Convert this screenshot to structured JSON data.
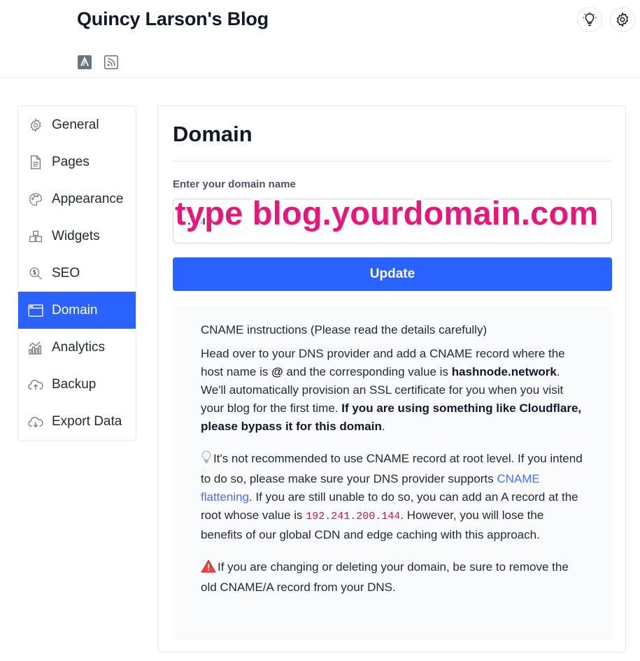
{
  "header": {
    "blog_title": "Quincy Larson's Blog",
    "social_icons": [
      "hashnode-icon",
      "rss-icon"
    ],
    "actions": [
      "lightbulb-icon",
      "gear-icon"
    ]
  },
  "sidebar": {
    "items": [
      {
        "label": "General",
        "icon": "gear-icon",
        "active": false
      },
      {
        "label": "Pages",
        "icon": "document-icon",
        "active": false
      },
      {
        "label": "Appearance",
        "icon": "palette-icon",
        "active": false
      },
      {
        "label": "Widgets",
        "icon": "widgets-icon",
        "active": false
      },
      {
        "label": "SEO",
        "icon": "search-dollar-icon",
        "active": false
      },
      {
        "label": "Domain",
        "icon": "browser-window-icon",
        "active": true
      },
      {
        "label": "Analytics",
        "icon": "bar-chart-icon",
        "active": false
      },
      {
        "label": "Backup",
        "icon": "cloud-upload-icon",
        "active": false
      },
      {
        "label": "Export Data",
        "icon": "cloud-download-icon",
        "active": false
      }
    ]
  },
  "main": {
    "title": "Domain",
    "field_label": "Enter your domain name",
    "input_value": "…on.…",
    "overlay_caption": "type blog.yourdomain.com",
    "update_label": "Update",
    "instructions": {
      "title": "CNAME instructions (Please read the details carefully)",
      "p1_a": "Head over to your DNS provider and add a CNAME record where the host name is ",
      "p1_at": "@",
      "p1_b": " and the corresponding value is ",
      "p1_value": "hashnode.network",
      "p1_c": ". We'll automatically provision an SSL certificate for you when you visit your blog for the first time. ",
      "p1_bold": "If you are using something like Cloudflare, please bypass it for this domain",
      "p1_end": ".",
      "p2_a": "It's not recommended to use CNAME record at root level. If you intend to do so, please make sure your DNS provider supports ",
      "p2_link": "CNAME flattening",
      "p2_b": ". If you are still unable to do so, you can add an A record at the root whose value is ",
      "p2_ip": "192.241.200.144",
      "p2_c": ". However, you will lose the benefits of our global CDN and edge caching with this approach.",
      "p3": "If you are changing or deleting your domain, be sure to remove the old CNAME/A record from your DNS."
    }
  },
  "colors": {
    "accent": "#2962ff",
    "overlay": "#e5177a",
    "code": "#be185d",
    "link": "#4c6ef5"
  }
}
